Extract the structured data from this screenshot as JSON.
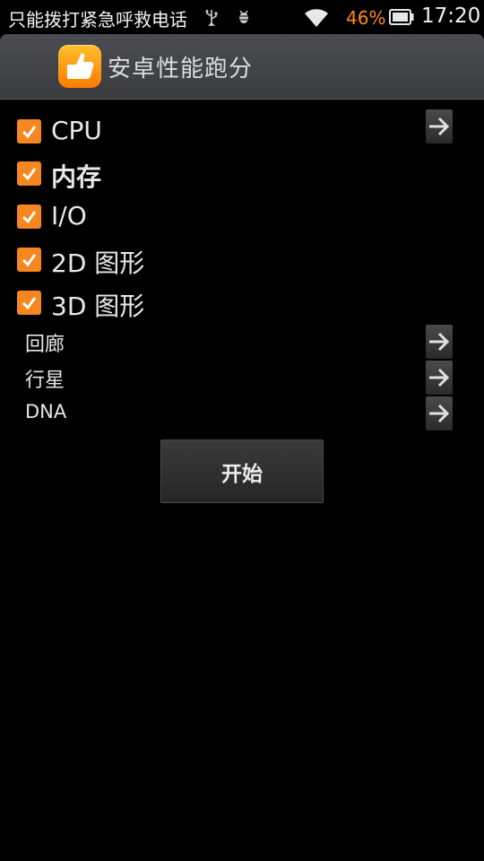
{
  "status_bar": {
    "carrier_text": "只能拨打紧急呼救电话",
    "battery_percent": "46%",
    "time": "17:20",
    "icons": [
      "usb-icon",
      "debug-icon",
      "wifi-icon",
      "battery-icon"
    ],
    "battery_color": "#ff8a1f"
  },
  "action_bar": {
    "title": "安卓性能跑分",
    "icon": "thumbs-up-icon"
  },
  "tests": [
    {
      "label": "CPU",
      "checked": true
    },
    {
      "label": "内存",
      "checked": true
    },
    {
      "label": "I/O",
      "checked": true
    },
    {
      "label": "2D 图形",
      "checked": true
    },
    {
      "label": "3D 图形",
      "checked": true
    }
  ],
  "sub_tests": [
    {
      "label": "回廊"
    },
    {
      "label": "行星"
    },
    {
      "label": "DNA"
    }
  ],
  "start_button": {
    "label": "开始"
  },
  "colors": {
    "accent": "#f6861f",
    "background": "#000000"
  }
}
